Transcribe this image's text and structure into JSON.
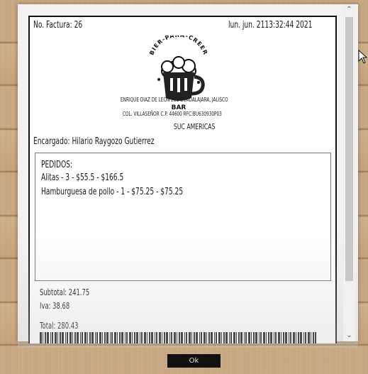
{
  "receipt": {
    "invoice": "No. Factura: 26",
    "datetime": "lun. jun. 2113:32:44 2021",
    "logo_top_text": "BIER-PARA-CREER",
    "logo_bottom_text": "BAR",
    "address_line1": "ENRIQUE DIAZ DE LEÓN 261 GUADALAJARA, JALISCO",
    "address_line2": "COL. VILLASEÑOR C.P. 44600 RFC:BU630930P03",
    "branch": "SUC AMERICAS",
    "manager": "Encargado: Hilario Raygozo Gutierrez",
    "orders_title": "PEDIDOS:",
    "items": [
      "Alitas - 3 - $55.5 - $166.5",
      "Hamburguesa de pollo - 1 - $75.25 - $75.25"
    ],
    "subtotal": "Subtotal: 241.75",
    "iva": "Iva: 38.68",
    "total": "Total: 280.43"
  },
  "dialog": {
    "ok_label": "Ok"
  },
  "icons": {
    "scroll_up": "chevron-up-icon",
    "scroll_down": "chevron-down-icon",
    "cursor": "mouse-pointer-icon"
  }
}
